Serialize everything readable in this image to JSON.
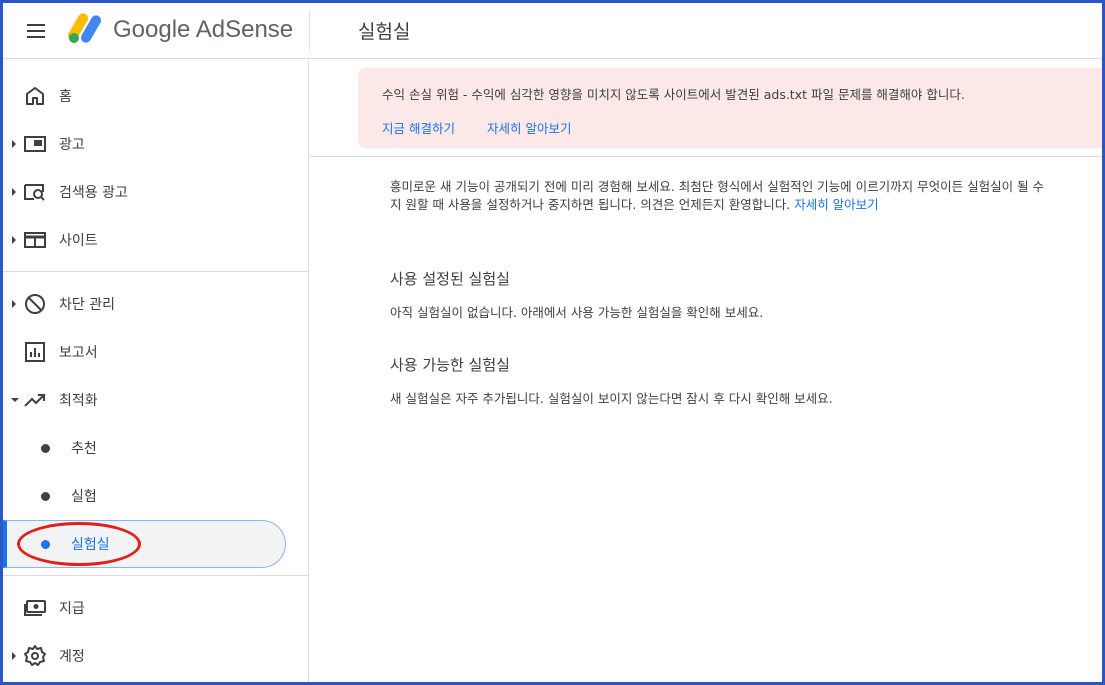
{
  "header": {
    "app_name": "Google AdSense",
    "page_title": "실험실"
  },
  "sidebar": {
    "items": [
      {
        "label": "홈",
        "icon": "home-icon"
      },
      {
        "label": "광고",
        "icon": "ads-icon"
      },
      {
        "label": "검색용 광고",
        "icon": "search-ads-icon"
      },
      {
        "label": "사이트",
        "icon": "sites-icon"
      },
      {
        "label": "차단 관리",
        "icon": "block-icon"
      },
      {
        "label": "보고서",
        "icon": "reports-icon"
      },
      {
        "label": "최적화",
        "icon": "optimization-icon"
      },
      {
        "label": "지급",
        "icon": "payments-icon"
      },
      {
        "label": "계정",
        "icon": "settings-icon"
      }
    ],
    "sub_items": [
      {
        "label": "추천"
      },
      {
        "label": "실험"
      },
      {
        "label": "실험실",
        "active": true
      }
    ]
  },
  "banner": {
    "message": "수익 손실 위험 - 수익에 심각한 영향을 미치지 않도록 사이트에서 발견된 ads.txt 파일 문제를 해결해야 합니다.",
    "fix_link": "지금 해결하기",
    "learn_link": "자세히 알아보기"
  },
  "intro": {
    "line1": "흥미로운 새 기능이 공개되기 전에 미리 경험해 보세요. 최첨단 형식에서 실험적인 기능에 이르기까지 무엇이든 실험실이 될 수",
    "line2": "지 원할 때 사용을 설정하거나 중지하면 됩니다. 의견은 언제든지 환영합니다.",
    "link": "자세히 알아보기"
  },
  "sections": {
    "enabled_title": "사용 설정된 실험실",
    "enabled_text": "아직 실험실이 없습니다. 아래에서 사용 가능한 실험실을 확인해 보세요.",
    "available_title": "사용 가능한 실험실",
    "available_text": "새 실험실은 자주 추가됩니다. 실험실이 보이지 않는다면 잠시 후 다시 확인해 보세요."
  },
  "colors": {
    "accent": "#1a73e8",
    "banner_bg": "#fce8e6",
    "annotation_red": "#e0201b",
    "frame_blue": "#2b56c6"
  }
}
